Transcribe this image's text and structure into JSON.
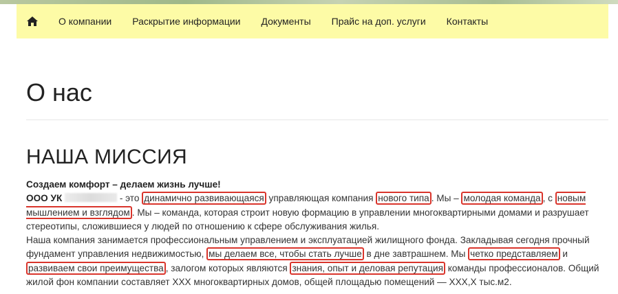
{
  "nav": {
    "home_icon": "home-icon",
    "items": [
      {
        "label": "О компании"
      },
      {
        "label": "Раскрытие информации"
      },
      {
        "label": "Документы"
      },
      {
        "label": "Прайс на доп. услуги"
      },
      {
        "label": "Контакты"
      }
    ],
    "background": "#fdfba6"
  },
  "page": {
    "title": "О нас",
    "section_title": "НАША МИССИЯ"
  },
  "mission": {
    "slogan": "Создаем комфорт – делаем жизнь лучше!",
    "company": "ООО УК",
    "p1": {
      "t1": " - это ",
      "h1": "динамично развивающаяся",
      "t2": " управляющая компания ",
      "h2": "нового типа",
      "t3": ". Мы – ",
      "h3": "молодая команда",
      "t4": ", с ",
      "h4": "новым мышлением и взглядом",
      "t5": ". Мы – команда, которая строит новую формацию в управлении многоквартирными домами и разрушает стереотипы, сложившиеся у людей по отношению к сфере обслуживания жилья."
    },
    "p2": {
      "t1": "Наша компания занимается профессиональным управлением и эксплуатацией жилищного фонда. Закладывая сегодня прочный фундамент управления недвижимостью, ",
      "h1": "мы делаем все, чтобы стать лучше",
      "t2": " в дне завтрашнем. Мы ",
      "h2": "четко представляем",
      "t3": " и ",
      "h3": "развиваем свои преимущества",
      "t4": ", залогом которых являются ",
      "h4": "знания, опыт и деловая репутация",
      "t5": " команды профессионалов. Общий жилой фон компании составляет ХХХ многоквартирных домов, общей площадью помещений — ХХХ,Х тыс.м2."
    },
    "highlight_color": "#d9342b"
  }
}
